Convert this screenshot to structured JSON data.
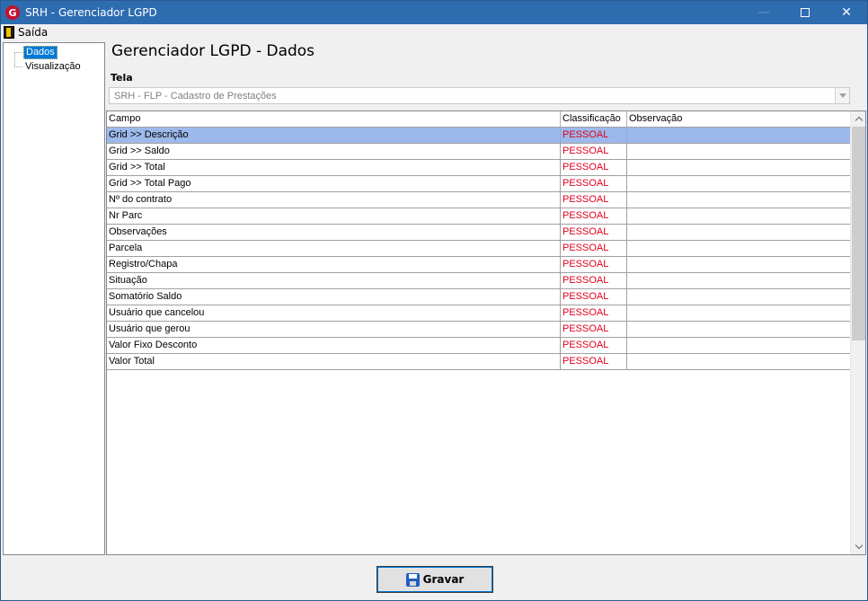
{
  "window": {
    "title": "SRH - Gerenciador LGPD",
    "app_icon_glyph": "G",
    "controls": {
      "minimize": "—",
      "close": "✕"
    }
  },
  "menu": {
    "exit_label": "Saída"
  },
  "tree": {
    "items": [
      {
        "label": "Dados",
        "selected": true
      },
      {
        "label": "Visualização",
        "selected": false
      }
    ]
  },
  "main": {
    "title": "Gerenciador LGPD - Dados",
    "tela_label": "Tela",
    "tela_value": "SRH - FLP - Cadastro de Prestações"
  },
  "grid": {
    "columns": [
      "Campo",
      "Classificação",
      "Observação"
    ],
    "rows": [
      {
        "campo": "Grid >> Descrição",
        "classificacao": "PESSOAL",
        "observacao": ""
      },
      {
        "campo": "Grid >> Saldo",
        "classificacao": "PESSOAL",
        "observacao": ""
      },
      {
        "campo": "Grid >> Total",
        "classificacao": "PESSOAL",
        "observacao": ""
      },
      {
        "campo": "Grid >> Total Pago",
        "classificacao": "PESSOAL",
        "observacao": ""
      },
      {
        "campo": "Nº do contrato",
        "classificacao": "PESSOAL",
        "observacao": ""
      },
      {
        "campo": "Nr Parc",
        "classificacao": "PESSOAL",
        "observacao": ""
      },
      {
        "campo": "Observações",
        "classificacao": "PESSOAL",
        "observacao": ""
      },
      {
        "campo": "Parcela",
        "classificacao": "PESSOAL",
        "observacao": ""
      },
      {
        "campo": "Registro/Chapa",
        "classificacao": "PESSOAL",
        "observacao": ""
      },
      {
        "campo": "Situação",
        "classificacao": "PESSOAL",
        "observacao": ""
      },
      {
        "campo": "Somatório Saldo",
        "classificacao": "PESSOAL",
        "observacao": ""
      },
      {
        "campo": "Usuário que cancelou",
        "classificacao": "PESSOAL",
        "observacao": ""
      },
      {
        "campo": "Usuário que gerou",
        "classificacao": "PESSOAL",
        "observacao": ""
      },
      {
        "campo": "Valor Fixo Desconto",
        "classificacao": "PESSOAL",
        "observacao": ""
      },
      {
        "campo": "Valor Total",
        "classificacao": "PESSOAL",
        "observacao": ""
      }
    ],
    "selected_row": 0
  },
  "footer": {
    "save_label": "Gravar"
  },
  "colors": {
    "titlebar": "#2e6cb0",
    "selection": "#9db9eb",
    "classification_text": "#e0001c",
    "tree_selection": "#0078d7"
  },
  "icons": {
    "app": "app-logo-icon",
    "exit": "exit-door-icon",
    "save": "floppy-disk-icon"
  }
}
